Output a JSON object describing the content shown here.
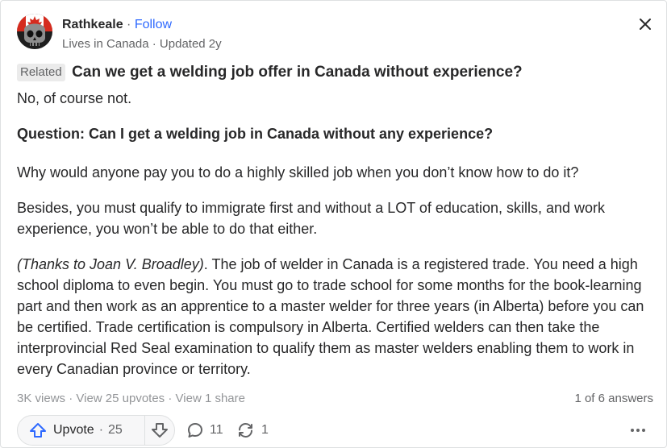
{
  "author": {
    "name": "Rathkeale",
    "separator": "·",
    "follow_label": "Follow",
    "credential": "Lives in Canada",
    "updated": "Updated 2y"
  },
  "question": {
    "related_label": "Related",
    "title": "Can we get a welding job offer in Canada without experience?"
  },
  "answer": {
    "p1": "No, of course not.",
    "p2": "Question: Can I get a welding job in Canada without any experience?",
    "p3": "Why would anyone pay you to do a highly skilled job when you don’t know how to do it?",
    "p4": "Besides, you must qualify to immigrate first and without a LOT of education, skills, and work experience, you won’t be able to do that either.",
    "p5_italic": "(Thanks to Joan V. Broadley)",
    "p5_rest": ". The job of welder in Canada is a registered trade. You need a high school diploma to even begin. You must go to trade school for some months for the book-learning part and then work as an apprentice to a master welder for three years (in Alberta) before you can be certified. Trade certification is compulsory in Alberta. Certified welders can then take the interprovincial Red Seal examination to qualify them as master welders enabling them to work in every Canadian province or territory."
  },
  "stats": {
    "views": "3K views",
    "upvotes": "View 25 upvotes",
    "shares": "View 1 share",
    "sep": " · ",
    "answer_position": "1 of 6 answers"
  },
  "actions": {
    "upvote_label": "Upvote",
    "upvote_sep": "·",
    "upvote_count": "25",
    "comment_count": "11",
    "share_count": "1"
  },
  "icons": {
    "avatar": "skull-canada-flag-avatar",
    "close": "close-icon",
    "upvote": "upvote-arrow-icon",
    "downvote": "downvote-arrow-icon",
    "comment": "comment-bubble-icon",
    "share": "share-cycle-icon",
    "more": "more-horizontal-icon"
  },
  "colors": {
    "link": "#2e69ff",
    "upvote_icon": "#2e69ff",
    "text_primary": "#282829",
    "text_secondary": "#636466",
    "canada_red": "#d52b1e"
  }
}
